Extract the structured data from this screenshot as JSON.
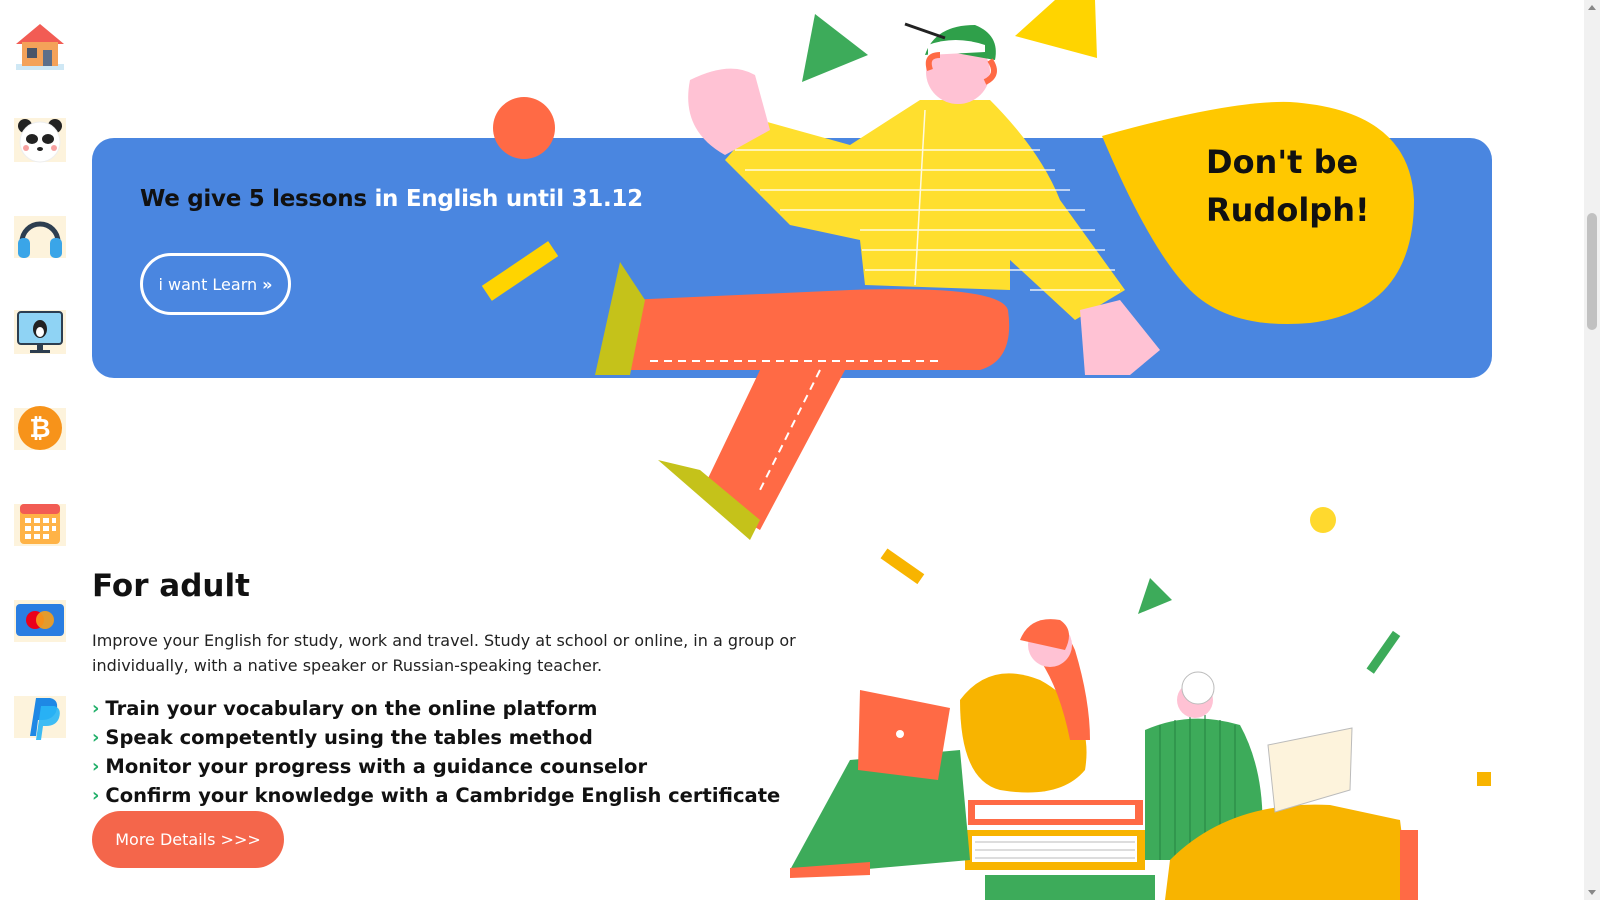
{
  "sidebar": {
    "items": [
      {
        "icon": "home-icon"
      },
      {
        "icon": "panda-icon"
      },
      {
        "icon": "headphones-icon"
      },
      {
        "icon": "monitor-penguin-icon"
      },
      {
        "icon": "bitcoin-icon"
      },
      {
        "icon": "calendar-icon"
      },
      {
        "icon": "mastercard-icon"
      },
      {
        "icon": "paypal-icon"
      }
    ]
  },
  "banner": {
    "title_dark": "We give 5 lessons",
    "title_light": "in English until 31.12",
    "button_label": "i want Learn",
    "button_icon": "double-chevron-right-icon",
    "bubble_line1": "Don't be",
    "bubble_line2": "Rudolph!"
  },
  "adult": {
    "title": "For adult",
    "description": "Improve your English for study, work and travel. Study at school or online, in a group or individually, with a native speaker or Russian-speaking teacher.",
    "features": [
      "Train your vocabulary on the online platform",
      "Speak competently using the tables method",
      "Monitor your progress with a guidance counselor",
      "Confirm your knowledge with a Cambridge English certificate"
    ],
    "button_label": "More Details >>>"
  },
  "colors": {
    "banner_blue": "#4a86e0",
    "bubble_yellow": "#ffc800",
    "accent_orange": "#f4664b",
    "check_green": "#22b06a"
  }
}
